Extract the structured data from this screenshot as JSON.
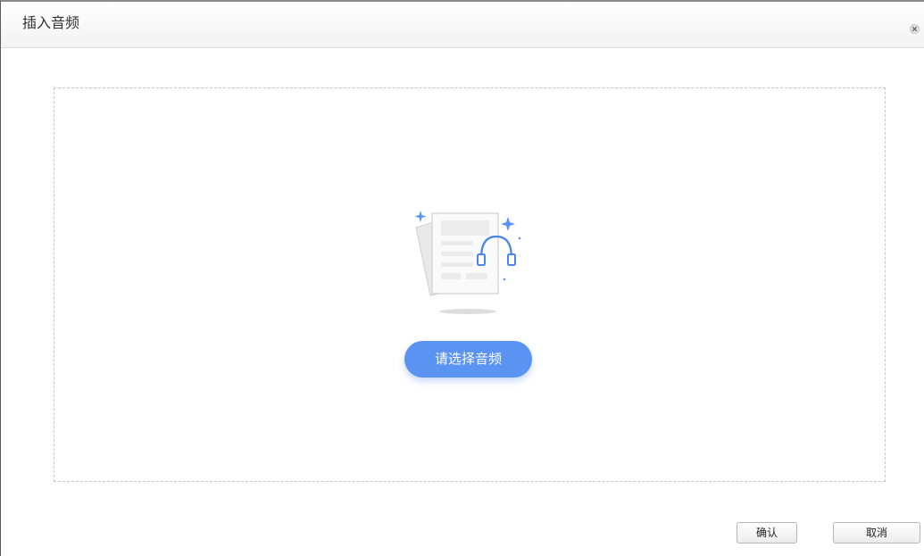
{
  "dialog": {
    "title": "插入音频",
    "close_icon": "close-circle-icon"
  },
  "dropzone": {
    "illustration_icon": "document-headphones-icon",
    "select_button_label": "请选择音频",
    "accent_color": "#5b93f2"
  },
  "footer": {
    "confirm_label": "确认",
    "cancel_label": "取消"
  }
}
